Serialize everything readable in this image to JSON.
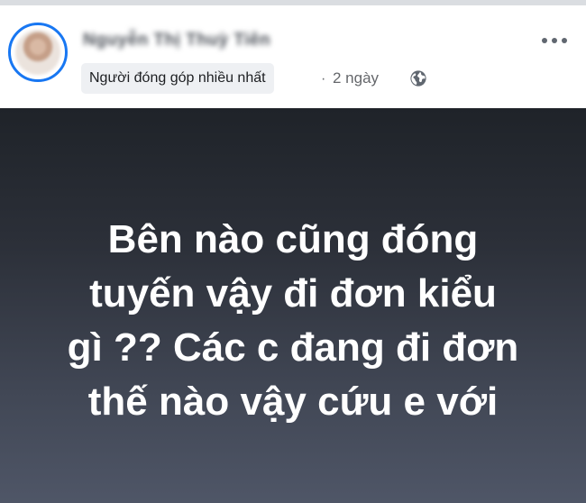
{
  "author": {
    "name": "Nguyễn Thị Thuỳ Tiên",
    "badge": "Người đóng góp nhiều nhất"
  },
  "meta": {
    "separator": "·",
    "time": "2 ngày",
    "privacy_icon": "globe-icon"
  },
  "menu": {
    "icon": "more-horizontal-icon"
  },
  "post": {
    "lines": [
      "Bên nào cũng đóng",
      "tuyến vậy đi đơn kiểu",
      "gì ?? Các c đang đi đơn",
      "thế nào vậy cứu e với"
    ],
    "background_top": "#1f2329",
    "background_bottom": "#4f5667",
    "text_color": "#ffffff"
  },
  "colors": {
    "accent": "#1877f2",
    "badge_bg": "#eef0f3",
    "meta_text": "#65676b"
  }
}
